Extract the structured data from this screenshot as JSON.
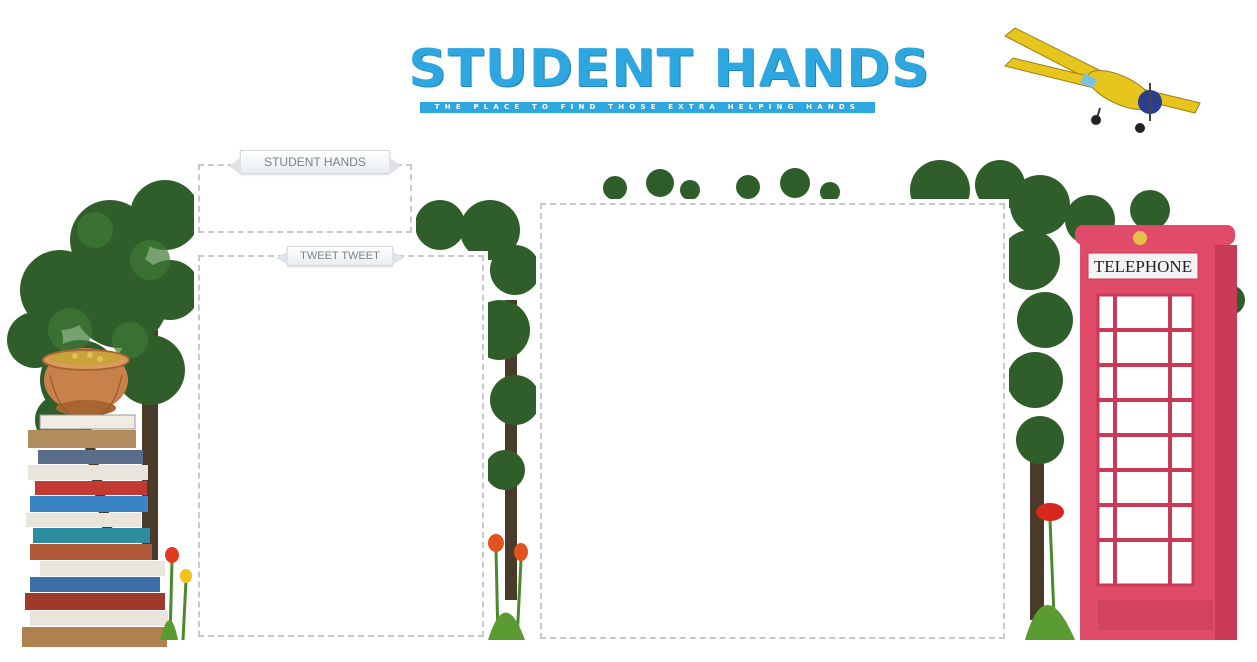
{
  "header": {
    "title": "STUDENT HANDS",
    "tagline": "THE PLACE TO FIND THOSE EXTRA HELPING HANDS"
  },
  "panels": {
    "intro": {
      "heading": "STUDENT HANDS"
    },
    "tweet": {
      "heading": "TWEET TWEET"
    }
  },
  "scenery": {
    "telephone_sign": "TELEPHONE"
  },
  "colors": {
    "brand_blue": "#2ea6df",
    "tree_green": "#2f5e2a",
    "phone_box_red": "#e04b69",
    "panel_border": "#c8c8c8",
    "plane_yellow": "#e8c51d"
  },
  "icons": [
    "biplane-icon",
    "tree-icon",
    "pot-of-gold-icon",
    "book-stack-icon",
    "telephone-box-icon",
    "tulip-icon"
  ]
}
